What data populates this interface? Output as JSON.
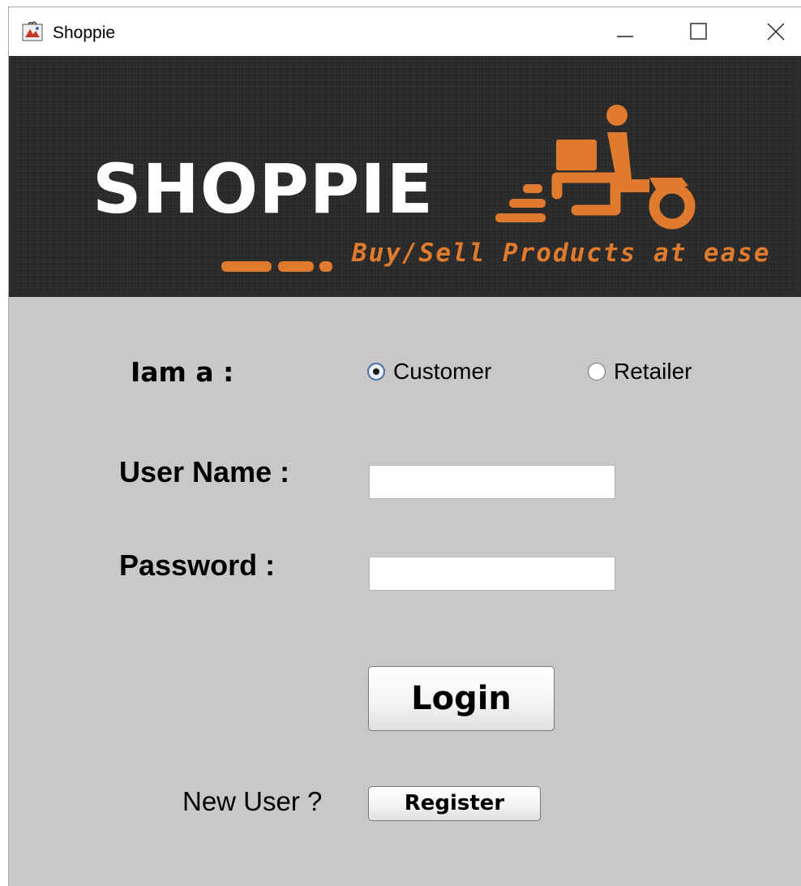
{
  "window": {
    "title": "Shoppie",
    "icon": "app-java-icon",
    "controls": [
      "minimize-icon",
      "maximize-icon",
      "close-icon"
    ]
  },
  "banner": {
    "brand": "SHOPPIE",
    "tagline": "Buy/Sell Products at ease",
    "logo": "delivery-scooter-icon",
    "colors": {
      "background": "#2a2a2a",
      "brand_text": "#ffffff",
      "accent": "#e07a2c"
    }
  },
  "form": {
    "role_label": "Iam a :",
    "roles": [
      {
        "label": "Customer",
        "selected": true
      },
      {
        "label": "Retailer",
        "selected": false
      }
    ],
    "username_label": "User Name :",
    "username_value": "",
    "password_label": "Password :",
    "password_value": "",
    "login_label": "Login",
    "new_user_label": "New User ?",
    "register_label": "Register"
  },
  "colors": {
    "panel_background": "#c8c8c8",
    "radio_selected_border": "#4a6ea8"
  }
}
